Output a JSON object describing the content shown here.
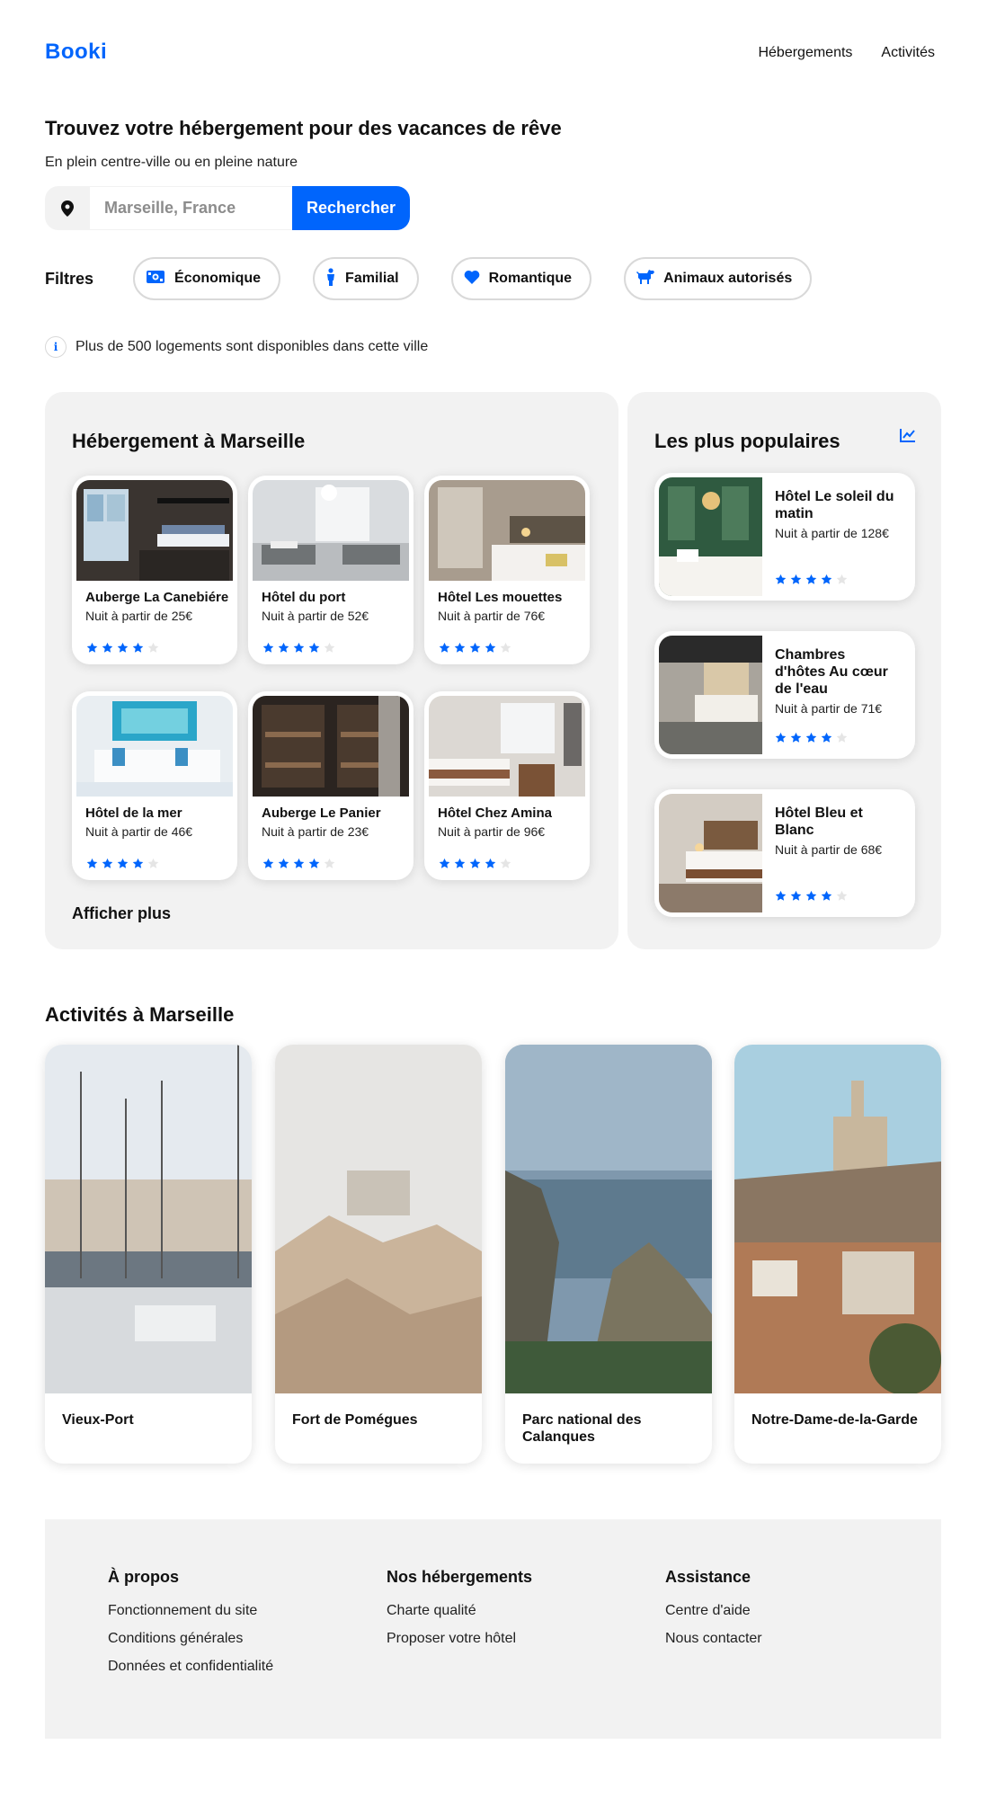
{
  "header": {
    "logo": "Booki",
    "nav": [
      "Hébergements",
      "Activités"
    ]
  },
  "hero": {
    "title": "Trouvez votre hébergement pour des vacances de rêve",
    "subtitle": "En plein centre-ville ou en pleine nature",
    "search_placeholder": "Marseille, France",
    "search_button": "Rechercher"
  },
  "filters": {
    "label": "Filtres",
    "items": [
      {
        "label": "Économique",
        "icon": "money-icon"
      },
      {
        "label": "Familial",
        "icon": "child-icon"
      },
      {
        "label": "Romantique",
        "icon": "heart-icon"
      },
      {
        "label": "Animaux autorisés",
        "icon": "dog-icon"
      }
    ]
  },
  "info": "Plus de 500 logements sont disponibles dans cette ville",
  "accommodations": {
    "title": "Hébergement à Marseille",
    "more": "Afficher plus",
    "items": [
      {
        "name": "Auberge La Canebiére",
        "price": "Nuit à partir de 25€",
        "rating": 4
      },
      {
        "name": "Hôtel du port",
        "price": "Nuit à partir de 52€",
        "rating": 4
      },
      {
        "name": "Hôtel Les mouettes",
        "price": "Nuit à partir de 76€",
        "rating": 4
      },
      {
        "name": "Hôtel de la mer",
        "price": "Nuit à partir de 46€",
        "rating": 4
      },
      {
        "name": "Auberge Le Panier",
        "price": "Nuit à partir de 23€",
        "rating": 4
      },
      {
        "name": "Hôtel Chez Amina",
        "price": "Nuit à partir de 96€",
        "rating": 4
      }
    ]
  },
  "popular": {
    "title": "Les plus populaires",
    "items": [
      {
        "name": "Hôtel Le soleil du matin",
        "price": "Nuit à partir de 128€",
        "rating": 4
      },
      {
        "name": "Chambres d'hôtes Au cœur de l'eau",
        "price": "Nuit à partir de 71€",
        "rating": 4
      },
      {
        "name": "Hôtel Bleu et Blanc",
        "price": "Nuit à partir de 68€",
        "rating": 4
      }
    ]
  },
  "activities": {
    "title": "Activités à Marseille",
    "items": [
      {
        "name": "Vieux-Port"
      },
      {
        "name": "Fort de Pomégues"
      },
      {
        "name": "Parc national des Calanques"
      },
      {
        "name": "Notre-Dame-de-la-Garde"
      }
    ]
  },
  "footer": {
    "columns": [
      {
        "title": "À propos",
        "links": [
          "Fonctionnement du site",
          "Conditions générales",
          "Données et confidentialité"
        ]
      },
      {
        "title": "Nos hébergements",
        "links": [
          "Charte qualité",
          "Proposer votre hôtel"
        ]
      },
      {
        "title": "Assistance",
        "links": [
          "Centre d'aide",
          "Nous contacter"
        ]
      }
    ]
  },
  "colors": {
    "accent": "#0065fc",
    "panel": "#f2f2f2",
    "star_off": "#e5e5e5"
  }
}
